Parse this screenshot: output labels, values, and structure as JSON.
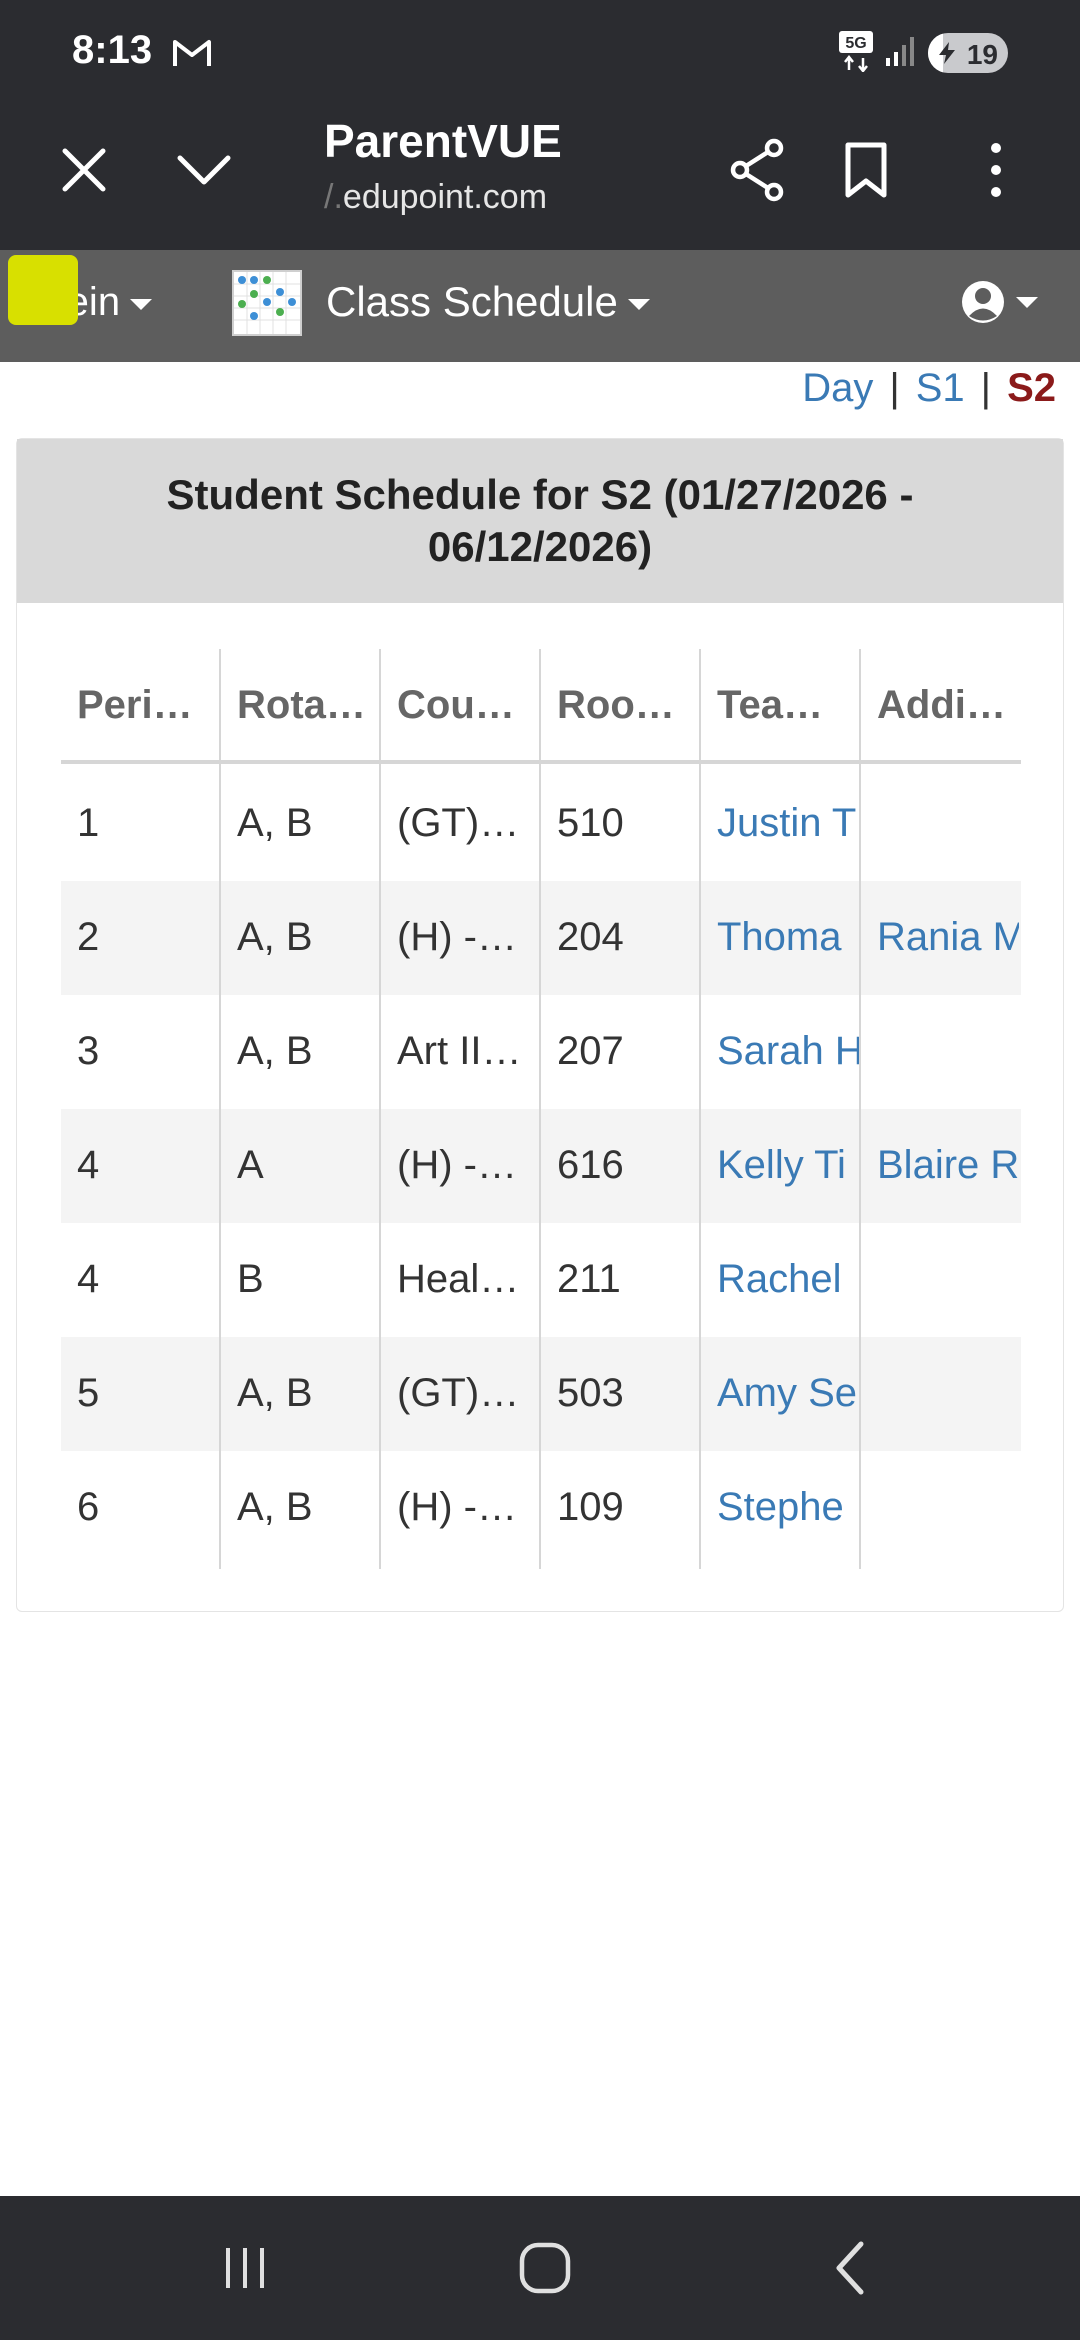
{
  "status_bar": {
    "time": "8:13",
    "network": "5G",
    "battery_level": "19",
    "battery_fraction": 0.19
  },
  "browser": {
    "title": "ParentVUE",
    "url_prefix": "/.",
    "url_main": "edupoint.com"
  },
  "app_nav": {
    "student_name": "Sein",
    "module_title": "Class Schedule"
  },
  "period_selector": {
    "day": "Day",
    "s1": "S1",
    "s2": "S2",
    "separator": "|"
  },
  "schedule": {
    "title": "Student Schedule for S2 (01/27/2026 - 06/12/2026)",
    "headers": [
      "Peri…",
      "Rota…",
      "Cou…",
      "Roo…",
      "Tea…",
      "Addi…"
    ],
    "rows": [
      {
        "period": "1",
        "rotation": "A, B",
        "course": "(GT)…",
        "room": "510",
        "teacher": "Justin T",
        "additional": ""
      },
      {
        "period": "2",
        "rotation": "A, B",
        "course": "(H) -…",
        "room": "204",
        "teacher": "Thoma",
        "additional": "Rania M"
      },
      {
        "period": "3",
        "rotation": "A, B",
        "course": "Art II…",
        "room": "207",
        "teacher": "Sarah H",
        "additional": ""
      },
      {
        "period": "4",
        "rotation": "A",
        "course": "(H) -…",
        "room": "616",
        "teacher": "Kelly Ti",
        "additional": "Blaire R"
      },
      {
        "period": "4",
        "rotation": "B",
        "course": "Heal…",
        "room": "211",
        "teacher": "Rachel",
        "additional": ""
      },
      {
        "period": "5",
        "rotation": "A, B",
        "course": "(GT)…",
        "room": "503",
        "teacher": "Amy Se",
        "additional": ""
      },
      {
        "period": "6",
        "rotation": "A, B",
        "course": "(H) -…",
        "room": "109",
        "teacher": "Stephe",
        "additional": ""
      }
    ]
  },
  "colors": {
    "link": "#3a7ab5",
    "active_period": "#8b1a1a",
    "highlight": "#d8e000"
  }
}
